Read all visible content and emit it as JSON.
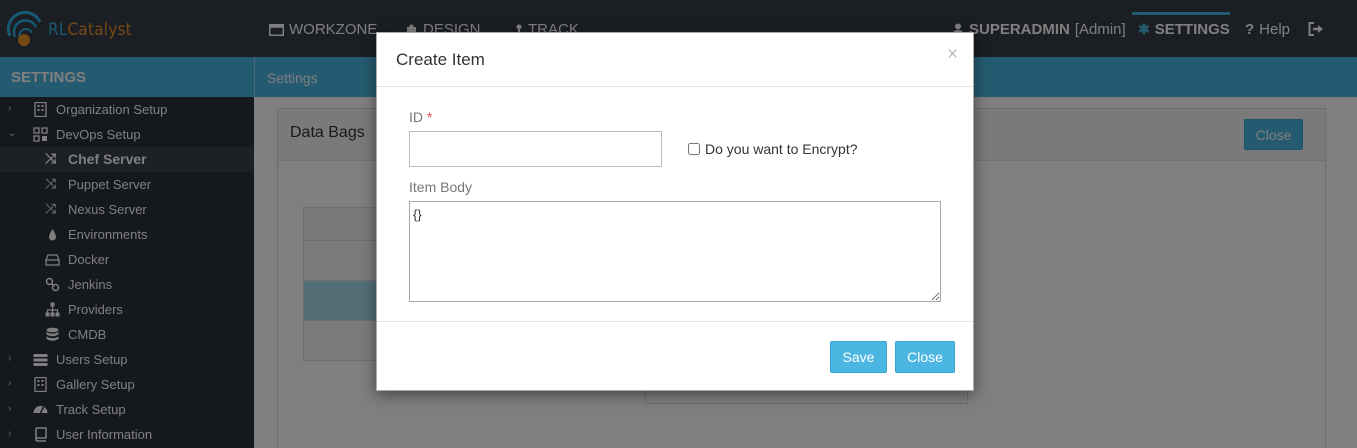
{
  "app": {
    "logo_text_rl": "RL",
    "logo_text_rest": "Catalyst",
    "brand_blue": "#4ab6e1",
    "brand_orange": "#e8922a"
  },
  "topnav": {
    "workzone": "WORKZONE",
    "design": "DESIGN",
    "track": "TRACK",
    "user_name": "SUPERADMIN",
    "user_role": "[Admin]",
    "settings": "SETTINGS",
    "help": "Help"
  },
  "sidebar": {
    "title": "SETTINGS",
    "items": [
      {
        "label": "Organization Setup",
        "icon": "building-icon"
      },
      {
        "label": "DevOps Setup",
        "icon": "grid-icon"
      },
      {
        "label": "Chef Server",
        "icon": "shuffle-icon"
      },
      {
        "label": "Puppet Server",
        "icon": "shuffle-icon"
      },
      {
        "label": "Nexus Server",
        "icon": "shuffle-icon"
      },
      {
        "label": "Environments",
        "icon": "drop-icon"
      },
      {
        "label": "Docker",
        "icon": "hdd-icon"
      },
      {
        "label": "Jenkins",
        "icon": "link-icon"
      },
      {
        "label": "Providers",
        "icon": "sitemap-icon"
      },
      {
        "label": "CMDB",
        "icon": "database-icon"
      },
      {
        "label": "Users Setup",
        "icon": "users-icon"
      },
      {
        "label": "Gallery Setup",
        "icon": "building-icon"
      },
      {
        "label": "Track Setup",
        "icon": "dashboard-icon"
      },
      {
        "label": "User Information",
        "icon": "book-icon"
      }
    ]
  },
  "breadcrumb": {
    "label": "Settings"
  },
  "panel": {
    "title": "Data Bags",
    "close_label": "Close"
  },
  "modal": {
    "title": "Create Item",
    "close_x": "×",
    "id_label": "ID",
    "id_required_mark": "*",
    "id_value": "",
    "encrypt_label": "Do you want to Encrypt?",
    "encrypt_checked": false,
    "item_body_label": "Item Body",
    "item_body_value": "{}",
    "save_label": "Save",
    "close_label": "Close"
  }
}
